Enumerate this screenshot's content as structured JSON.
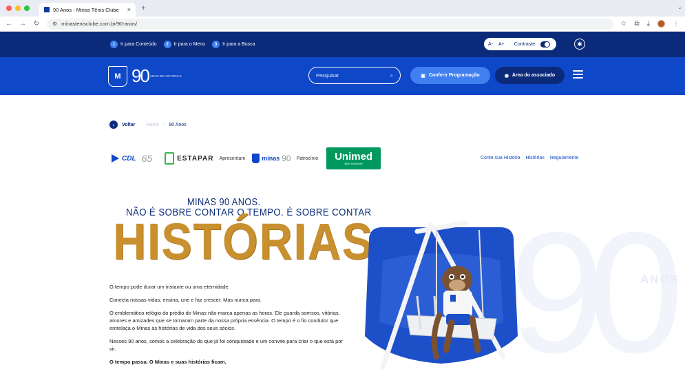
{
  "browser": {
    "tab_title": "90 Anos - Minas Tênis Clube",
    "tab_close": "×",
    "new_tab": "+",
    "url": "minastenisclube.com.br/90-anos/",
    "colors": {
      "close": "#ff5f57",
      "minimize": "#febc2e",
      "maximize": "#28c840"
    }
  },
  "access_bar": {
    "skip_links": [
      {
        "num": "1",
        "label": "Ir para Conteúdo"
      },
      {
        "num": "2",
        "label": "Ir para o Menu"
      },
      {
        "num": "3",
        "label": "Ir para a Busca"
      }
    ],
    "font_decrease": "A-",
    "font_increase": "A+",
    "contrast_label": "Contraste"
  },
  "header": {
    "logo_text": "90",
    "logo_sub": "ANOS DE HISTÓRIAS",
    "search_placeholder": "Pesquisar",
    "program_button": "Conferir Programação",
    "associate_button": "Área do associado"
  },
  "breadcrumb": {
    "back": "Voltar",
    "home": "Home",
    "current": "90 Anos"
  },
  "sponsors": {
    "cdl": "CDL",
    "cdl_num": "65",
    "estapar": "ESTAPAR",
    "presents": "Apresentam",
    "minas": "minas",
    "minas_90": "90",
    "sponsorship": "Patrocínio",
    "unimed": "Unimed",
    "unimed_sub": "Belo Horizonte"
  },
  "right_links": [
    "Conte sua História",
    "Histórias",
    "Regulamento"
  ],
  "hero": {
    "line1": "MINAS 90 ANOS.",
    "line2": "NÃO É SOBRE CONTAR O TEMPO. É SOBRE CONTAR",
    "big": "HISTÓRIAS."
  },
  "copy": [
    "O tempo pode durar um instante ou uma eternidade.",
    "Conecta nossas vidas, ensina, une e faz crescer. Mas nunca para.",
    "O emblemático relógio do prédio do Minas não marca apenas as horas. Ele guarda sorrisos, vitórias, amores e amizades que se tornaram parte da nossa própria essência. O tempo é o fio condutor que entrelaça o Minas às histórias de vida dos seus sócios.",
    "Nesses 90 anos, somos a celebração do que já foi conquistado e um convite para criar o que está por vir."
  ],
  "copy_strong": "O tempo passa. O Minas e suas histórias ficam.",
  "watermark": {
    "number": "90",
    "anos": "ANOS"
  }
}
